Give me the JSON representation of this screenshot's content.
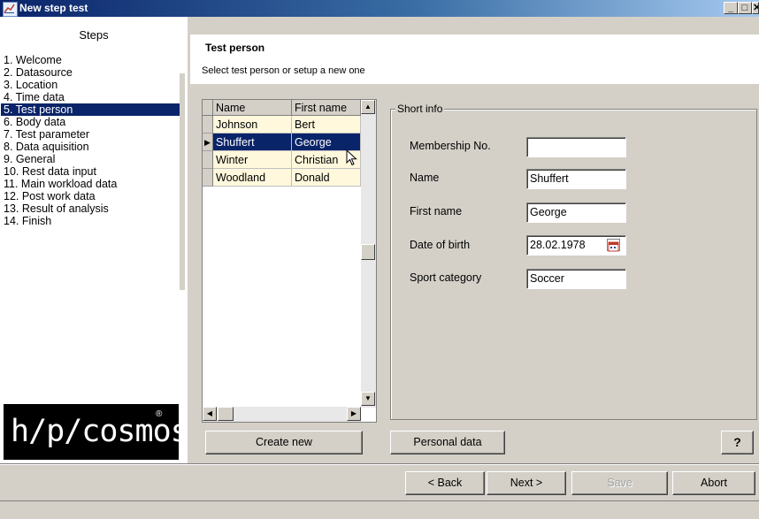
{
  "window": {
    "title": "New step test",
    "controls": {
      "minimize": "_",
      "maximize": "□",
      "close": "✕"
    }
  },
  "steps": {
    "heading": "Steps",
    "items": [
      "1. Welcome",
      "2. Datasource",
      "3. Location",
      "4. Time data",
      "5. Test person",
      "6. Body data",
      "7. Test parameter",
      "8. Data aquisition",
      "9. General",
      "10. Rest data input",
      "11. Main workload data",
      "12. Post work data",
      "13. Result of analysis",
      "14. Finish"
    ],
    "active_index": 4
  },
  "logo": {
    "text": "h/p/cosmos",
    "mark": "®"
  },
  "section": {
    "title": "Test person",
    "subtitle": "Select test person or setup a new one"
  },
  "grid": {
    "columns": [
      "Name",
      "First name"
    ],
    "rows": [
      [
        "Johnson",
        "Bert"
      ],
      [
        "Shuffert",
        "George"
      ],
      [
        "Winter",
        "Christian"
      ],
      [
        "Woodland",
        "Donald"
      ]
    ],
    "selected_row": 1,
    "row_indicator": "▶"
  },
  "short_info": {
    "legend": "Short info",
    "fields": [
      {
        "label": "Membership No.",
        "value": ""
      },
      {
        "label": "Name",
        "value": "Shuffert"
      },
      {
        "label": "First name",
        "value": "George"
      },
      {
        "label": "Date of birth",
        "value": "28.02.1978"
      },
      {
        "label": "Sport category",
        "value": "Soccer"
      }
    ]
  },
  "buttons": {
    "create_new": "Create new",
    "personal_data": "Personal data",
    "help": "?",
    "back": "< Back",
    "next": "Next >",
    "save": "Save",
    "abort": "Abort"
  },
  "colors": {
    "selection": "#0a246a",
    "grid_cell": "#fff8dc",
    "window_bg": "#d4d0c8"
  }
}
